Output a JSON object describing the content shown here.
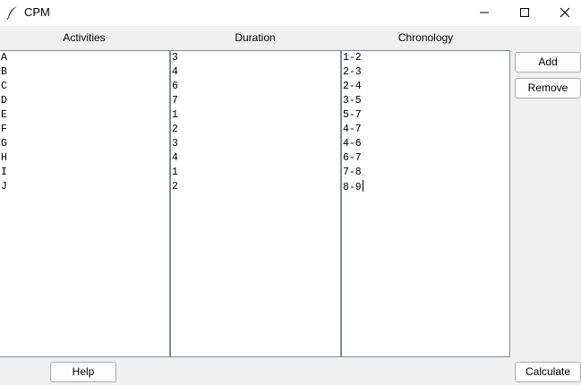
{
  "window": {
    "title": "CPM"
  },
  "headers": {
    "activities": "Activities",
    "duration": "Duration",
    "chronology": "Chronology"
  },
  "columns": {
    "activities": [
      "A",
      "B",
      "C",
      "D",
      "E",
      "F",
      "G",
      "H",
      "I",
      "J"
    ],
    "duration": [
      "3",
      "4",
      "6",
      "7",
      "1",
      "2",
      "3",
      "4",
      "1",
      "2"
    ],
    "chronology": [
      "1-2",
      "2-3",
      "2-4",
      "3-5",
      "5-7",
      "4-7",
      "4-6",
      "6-7",
      "7-8",
      "8-9"
    ]
  },
  "buttons": {
    "add": "Add",
    "remove": "Remove",
    "help": "Help",
    "calculate": "Calculate"
  },
  "icons": {
    "app": "feather-icon",
    "minimize": "minimize-icon",
    "maximize": "maximize-icon",
    "close": "close-icon"
  }
}
